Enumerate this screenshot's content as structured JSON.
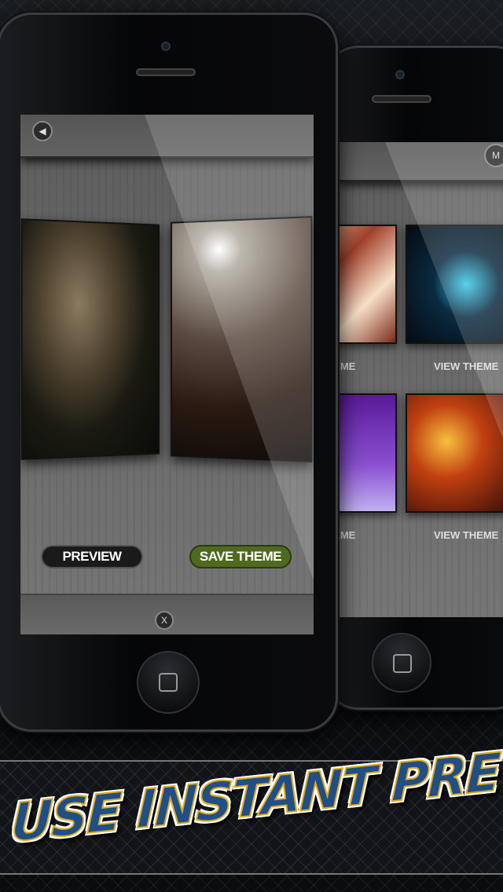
{
  "front_screen": {
    "back_icon": "triangle-left-icon",
    "preview_label": "PREVIEW",
    "save_label": "SAVE THEME",
    "close_label": "X",
    "colors": {
      "save": "#4f6a1e",
      "preview": "#1a1a1a"
    }
  },
  "back_screen": {
    "menu_label": "M",
    "items": [
      {
        "label": "VIEW THEME"
      },
      {
        "label": "VIEW THEME"
      },
      {
        "label": "VIEW THEME"
      },
      {
        "label": "VIEW THEME"
      }
    ]
  },
  "banner": {
    "headline": "USE INSTANT PREVIEW",
    "colors": {
      "fill": "#1f4f86",
      "stroke": "#e0a820"
    }
  }
}
